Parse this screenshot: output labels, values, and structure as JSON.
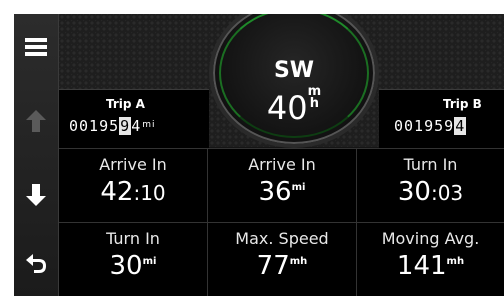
{
  "sidebar": {
    "buttons": [
      {
        "name": "menu-icon"
      },
      {
        "name": "arrow-up-icon"
      },
      {
        "name": "arrow-down-icon"
      },
      {
        "name": "back-icon"
      }
    ]
  },
  "compass": {
    "heading": "SW",
    "speed_value": "40",
    "speed_unit_top": "m",
    "speed_unit_bottom": "h",
    "ring_color": "#1f8a2a"
  },
  "trip_a": {
    "label": "Trip A",
    "odometer_prefix": "00195",
    "odometer_highlight": "9",
    "odometer_next": "4",
    "unit": "mi"
  },
  "trip_b": {
    "label": "Trip B",
    "odometer_prefix": "00195",
    "odometer_highlight": "9",
    "odometer_next": "4"
  },
  "fields": [
    {
      "label": "Arrive In",
      "value": "42",
      "value_suffix": ":10",
      "unit": ""
    },
    {
      "label": "Arrive In",
      "value": "36",
      "value_suffix": "",
      "unit": "mi"
    },
    {
      "label": "Turn In",
      "value": "30",
      "value_suffix": ":03",
      "unit": ""
    },
    {
      "label": "Turn In",
      "value": "30",
      "value_suffix": "",
      "unit": "mi"
    },
    {
      "label": "Max. Speed",
      "value": "77",
      "value_suffix": "",
      "unit": "mh"
    },
    {
      "label": "Moving Avg.",
      "value": "141",
      "value_suffix": "",
      "unit": "mh"
    }
  ]
}
